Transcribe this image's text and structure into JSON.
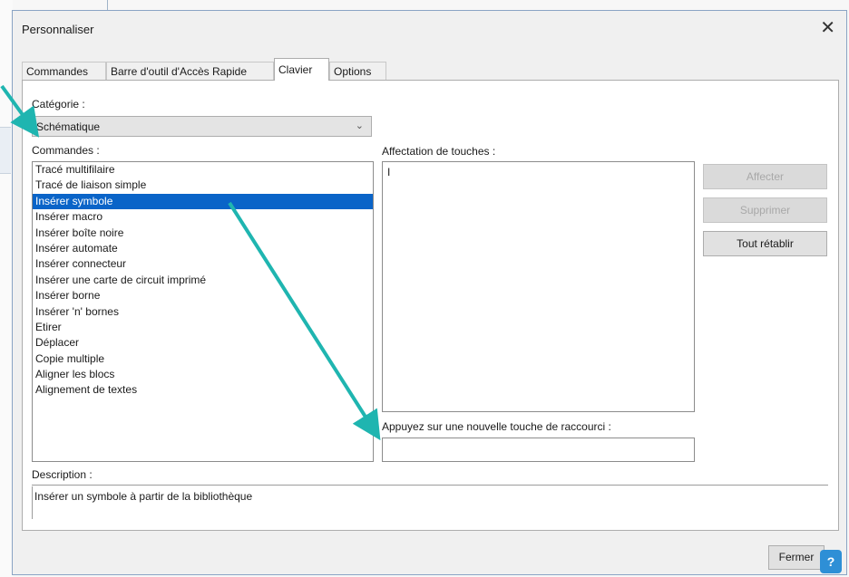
{
  "dialog": {
    "title": "Personnaliser",
    "close_glyph": "✕"
  },
  "tabs": [
    {
      "label": "Commandes",
      "active": false
    },
    {
      "label": "Barre d'outil d'Accès Rapide",
      "active": false
    },
    {
      "label": "Clavier",
      "active": true
    },
    {
      "label": "Options",
      "active": false
    }
  ],
  "category": {
    "label": "Catégorie :",
    "selected": "Schématique"
  },
  "commands": {
    "label": "Commandes :",
    "items": [
      "Tracé multifilaire",
      "Tracé de liaison simple",
      "Insérer symbole",
      "Insérer macro",
      "Insérer boîte noire",
      "Insérer automate",
      "Insérer connecteur",
      "Insérer une carte de circuit imprimé",
      "Insérer borne",
      "Insérer 'n' bornes",
      "Etirer",
      "Déplacer",
      "Copie multiple",
      "Aligner les blocs",
      "Alignement de textes"
    ],
    "selected_index": 2
  },
  "keys": {
    "label": "Affectation de touches :",
    "cursor": "I"
  },
  "shortcut": {
    "label": "Appuyez sur une nouvelle touche de raccourci :",
    "value": ""
  },
  "buttons": {
    "assign": "Affecter",
    "delete": "Supprimer",
    "reset_all": "Tout rétablir",
    "close": "Fermer"
  },
  "description": {
    "label": "Description :",
    "text": "Insérer un symbole à partir de la bibliothèque"
  },
  "colors": {
    "selection": "#0a64c8",
    "annotation_arrow": "#1fb5b0",
    "help_icon": "#2e8fd6"
  },
  "icons": {
    "close": "close-icon",
    "dropdown": "chevron-down-icon",
    "help": "help-icon"
  }
}
